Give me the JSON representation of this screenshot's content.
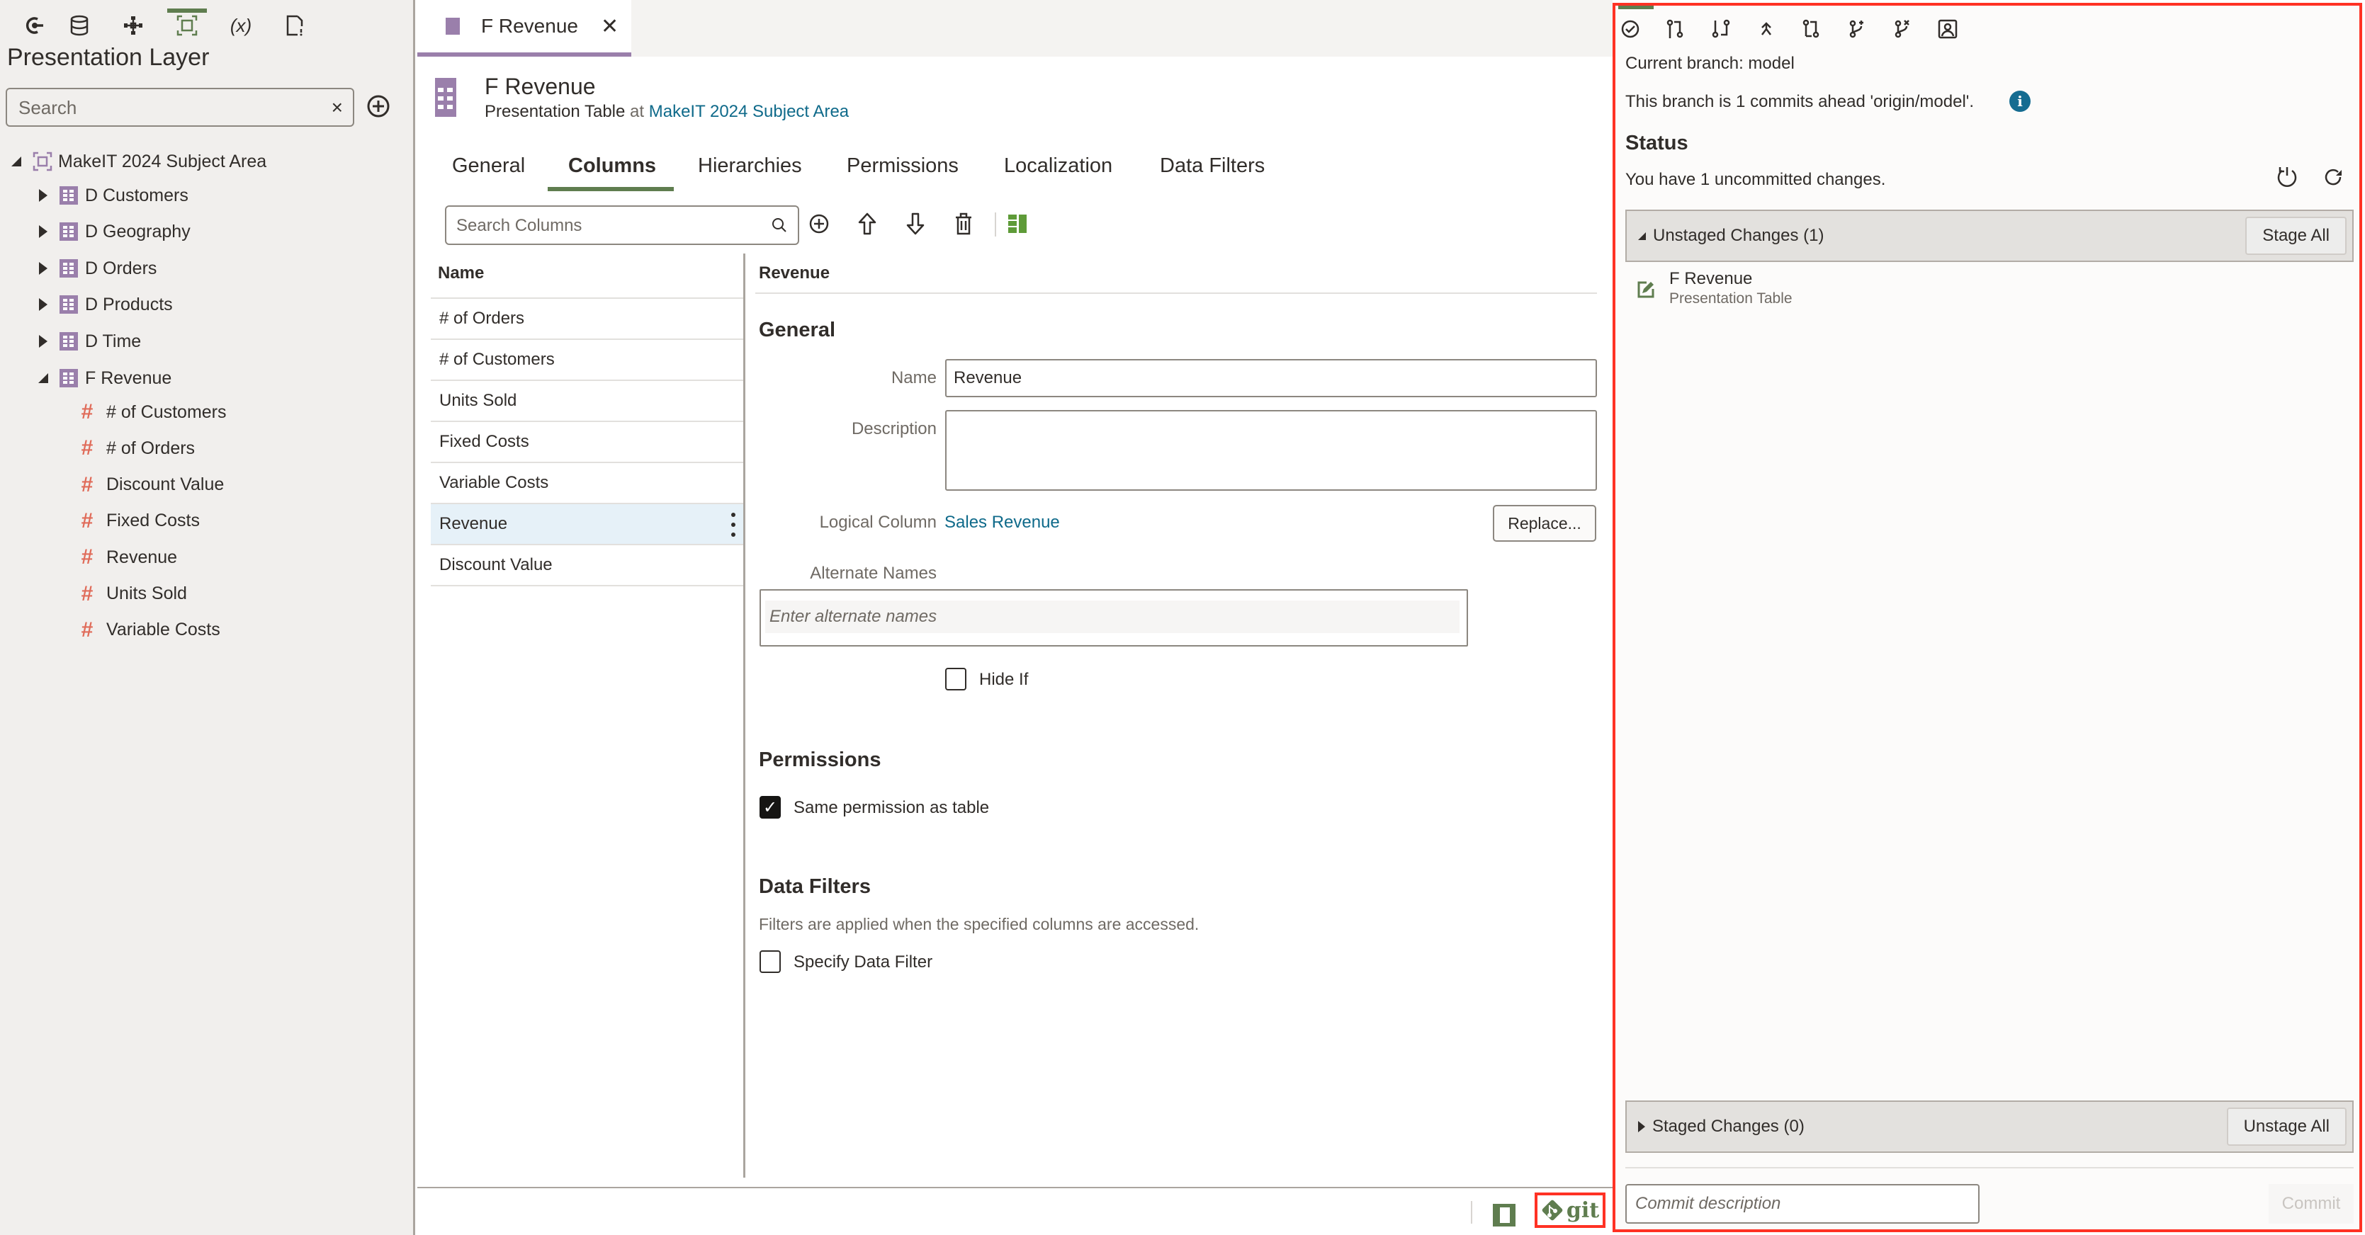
{
  "left_panel": {
    "toolbar": [
      {
        "name": "physical-layer-icon",
        "active": false
      },
      {
        "name": "database-icon",
        "active": false
      },
      {
        "name": "logical-layer-icon",
        "active": false
      },
      {
        "name": "presentation-layer-icon",
        "active": true
      },
      {
        "name": "variables-icon",
        "active": false,
        "glyph": "(x)"
      },
      {
        "name": "file-warning-icon",
        "active": false
      }
    ],
    "title": "Presentation Layer",
    "search": {
      "placeholder": "Search",
      "value": "",
      "clear_glyph": "×"
    },
    "tree": {
      "root": {
        "label": "MakeIT 2024 Subject Area",
        "expanded": true
      },
      "tables": [
        {
          "label": "D Customers",
          "expanded": false
        },
        {
          "label": "D Geography",
          "expanded": false
        },
        {
          "label": "D Orders",
          "expanded": false
        },
        {
          "label": "D Products",
          "expanded": false
        },
        {
          "label": "D Time",
          "expanded": false
        },
        {
          "label": "F Revenue",
          "expanded": true
        }
      ],
      "columns": [
        "# of Customers",
        "# of Orders",
        "Discount Value",
        "Fixed Costs",
        "Revenue",
        "Units Sold",
        "Variable Costs"
      ],
      "column_glyph": "#"
    }
  },
  "editor": {
    "tab": {
      "label": "F Revenue",
      "close_glyph": "✕"
    },
    "header": {
      "title": "F Revenue",
      "type": "Presentation Table",
      "at": "at",
      "parent_link": "MakeIT 2024 Subject Area"
    },
    "subtabs": [
      "General",
      "Columns",
      "Hierarchies",
      "Permissions",
      "Localization",
      "Data Filters"
    ],
    "active_subtab": "Columns",
    "column_search": {
      "placeholder": "Search Columns",
      "value": ""
    },
    "columns_list": {
      "header": "Name",
      "rows": [
        "# of Orders",
        "# of Customers",
        "Units Sold",
        "Fixed Costs",
        "Variable Costs",
        "Revenue",
        "Discount Value"
      ],
      "selected": "Revenue"
    },
    "detail": {
      "title": "Revenue",
      "general_heading": "General",
      "name_label": "Name",
      "name_value": "Revenue",
      "description_label": "Description",
      "description_value": "",
      "logical_column_label": "Logical Column",
      "logical_column_value": "Sales Revenue",
      "replace_label": "Replace...",
      "alternate_names_label": "Alternate Names",
      "alternate_names_placeholder": "Enter alternate names",
      "hide_if_label": "Hide If",
      "hide_if_checked": false,
      "permissions_heading": "Permissions",
      "same_permission_label": "Same permission as table",
      "same_permission_checked": true,
      "data_filters_heading": "Data Filters",
      "data_filters_desc": "Filters are applied when the specified columns are accessed.",
      "specify_filter_label": "Specify Data Filter",
      "specify_filter_checked": false
    },
    "footer": {
      "git_label": "git"
    }
  },
  "git_panel": {
    "toolbar": [
      "commit-check-icon",
      "pull-request-icon",
      "merge-icon",
      "push-icon",
      "compare-icon",
      "branch-add-icon",
      "branch-delete-icon",
      "user-profile-icon"
    ],
    "current_branch": "Current branch: model",
    "ahead_text": "This branch is 1 commits ahead 'origin/model'.",
    "status_heading": "Status",
    "uncommitted_text": "You have 1 uncommitted changes.",
    "unstaged": {
      "label": "Unstaged Changes (1)",
      "expanded": true,
      "button": "Stage All",
      "items": [
        {
          "name": "F Revenue",
          "type": "Presentation Table"
        }
      ]
    },
    "staged": {
      "label": "Staged Changes (0)",
      "expanded": false,
      "button": "Unstage All"
    },
    "commit_placeholder": "Commit description",
    "commit_label": "Commit"
  },
  "colors": {
    "accent_green": "#5f7d4f",
    "table_purple": "#9a7fab",
    "column_red": "#e06c5a",
    "link_blue": "#0f6a8a",
    "highlight_red": "#ff3224",
    "selected_row": "#e6f1f8"
  }
}
